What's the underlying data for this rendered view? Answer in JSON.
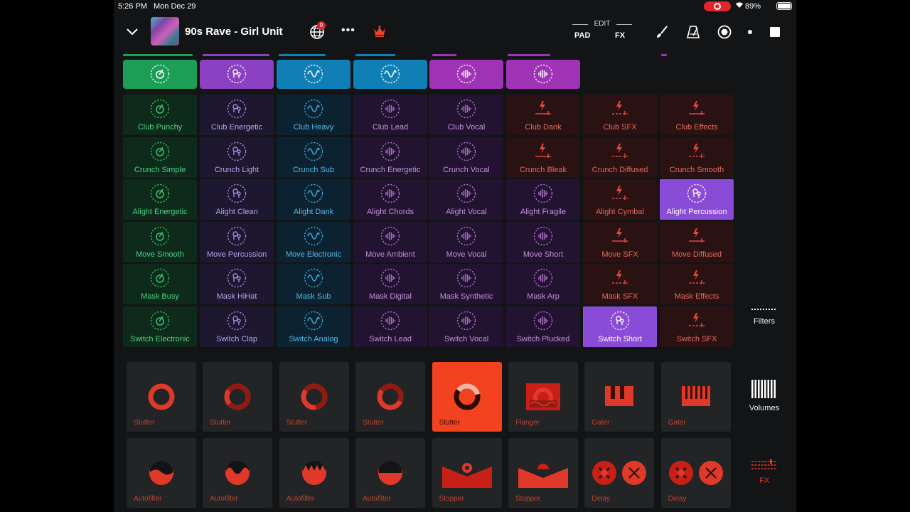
{
  "status_bar": {
    "time": "5:26 PM",
    "date": "Mon Dec 29",
    "battery": "89%",
    "battery_level": 0.89
  },
  "top_bar": {
    "song_title": "90s Rave - Girl Unit",
    "notification_count": "9",
    "more_label": "•••",
    "edit_label": "EDIT",
    "pad_label": "PAD",
    "fx_label": "FX"
  },
  "colors": {
    "green": "#1d9e57",
    "purple": "#8b41c2",
    "blue": "#0f7fb6",
    "violet": "#9e33b6",
    "red": "#e0392a",
    "selected": "#8a4bd6"
  },
  "header_icons": [
    "drum-icon",
    "percussion-icon",
    "wave-icon",
    "wave-icon",
    "vocal-icon",
    "vocal-icon"
  ],
  "grid": {
    "columns": [
      {
        "icon": "drum-icon",
        "labels": [
          "Club Punchy",
          "Crunch Simple",
          "Alight Energetic",
          "Move Smooth",
          "Mask Busy",
          "Switch Electronic"
        ]
      },
      {
        "icon": "percussion-icon",
        "labels": [
          "Club Energetic",
          "Crunch Light",
          "Alight Clean",
          "Move Percussion",
          "Mask HiHat",
          "Switch Clap"
        ]
      },
      {
        "icon": "wave-icon",
        "labels": [
          "Club Heavy",
          "Crunch Sub",
          "Alight Dank",
          "Move Electronic",
          "Mask Sub",
          "Switch Analog"
        ]
      },
      {
        "icon": "vocal-icon",
        "labels": [
          "Club Lead",
          "Crunch Energetic",
          "Alight Chords",
          "Move Ambient",
          "Mask Digital",
          "Switch Lead"
        ]
      },
      {
        "icon": "vocal-icon",
        "labels": [
          "Club Vocal",
          "Crunch Vocal",
          "Alight Vocal",
          "Move Vocal",
          "Mask Synthetic",
          "Switch Vocal"
        ]
      },
      {
        "icon": "mixed",
        "labels": [
          "Club Dank",
          "Crunch Bleak",
          "Alight Fragile",
          "Move Short",
          "Mask Arp",
          "Switch Plucked"
        ]
      },
      {
        "icon": "mixed",
        "labels": [
          "Club SFX",
          "Crunch Diffused",
          "Alight Cymbal",
          "Move SFX",
          "Mask SFX",
          "Switch Short"
        ]
      },
      {
        "icon": "mixed",
        "labels": [
          "Club Effects",
          "Crunch Smooth",
          "Alight Percussion",
          "Move Diffused",
          "Mask Effects",
          "Switch SFX"
        ]
      }
    ]
  },
  "fx_row1": [
    {
      "label": "Stutter",
      "icon": "stutter-ring-icon"
    },
    {
      "label": "Stutter",
      "icon": "stutter-ring-icon"
    },
    {
      "label": "Stutter",
      "icon": "stutter-ring-icon"
    },
    {
      "label": "Stutter",
      "icon": "stutter-ring-icon"
    },
    {
      "label": "Stutter",
      "icon": "stutter-ring-icon"
    },
    {
      "label": "Flanger",
      "icon": "flanger-icon"
    },
    {
      "label": "Gater",
      "icon": "gater-icon"
    },
    {
      "label": "Gater",
      "icon": "gater-icon"
    }
  ],
  "fx_row2": [
    {
      "label": "Autofilter",
      "icon": "autofilter-icon"
    },
    {
      "label": "Autofilter",
      "icon": "autofilter-icon"
    },
    {
      "label": "Autofilter",
      "icon": "autofilter-icon"
    },
    {
      "label": "Autofilter",
      "icon": "autofilter-icon"
    },
    {
      "label": "Stopper",
      "icon": "stopper-icon"
    },
    {
      "label": "Stopper",
      "icon": "stopper-icon"
    },
    {
      "label": "Delay",
      "icon": "delay-icon"
    },
    {
      "label": "Delay",
      "icon": "delay-icon"
    }
  ],
  "side_menu": {
    "filters": "Filters",
    "volumes": "Volumes",
    "fx": "FX"
  }
}
